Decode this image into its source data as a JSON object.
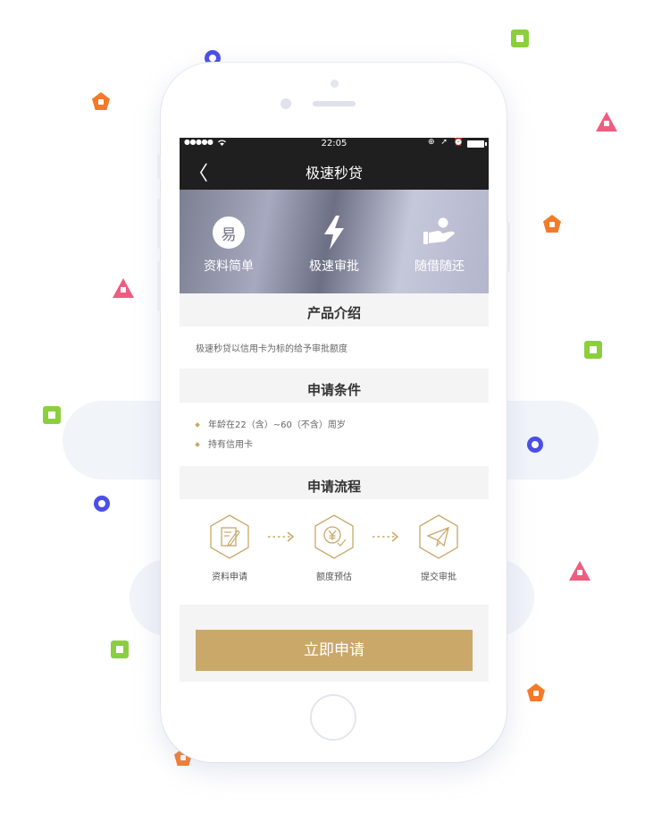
{
  "status_bar": {
    "signal": "●●●●●",
    "time": "22:05",
    "icons": "⊕ ➚ ⏰"
  },
  "nav": {
    "back": "〈",
    "title": "极速秒贷"
  },
  "features": [
    {
      "icon": "yi-badge-icon",
      "icon_text": "易",
      "label": "资料简单"
    },
    {
      "icon": "lightning-icon",
      "label": "极速审批"
    },
    {
      "icon": "hand-coin-icon",
      "label": "随借随还"
    }
  ],
  "intro": {
    "heading": "产品介绍",
    "text": "极速秒贷以信用卡为标的给予审批额度"
  },
  "conditions": {
    "heading": "申请条件",
    "items": [
      "年龄在22（含）~60（不含）周岁",
      "持有信用卡"
    ]
  },
  "process": {
    "heading": "申请流程",
    "steps": [
      {
        "icon": "edit-document-icon",
        "label": "资料申请"
      },
      {
        "icon": "yen-coin-icon",
        "label": "额度预估"
      },
      {
        "icon": "paper-plane-icon",
        "label": "提交审批"
      }
    ]
  },
  "apply_button": "立即申请",
  "colors": {
    "gold": "#c9a86a",
    "navbar": "#1f1f1f",
    "ring": "#4b4fe6",
    "square": "#8ccf3c",
    "pentagon": "#f47a29",
    "triangle": "#f05c80"
  }
}
